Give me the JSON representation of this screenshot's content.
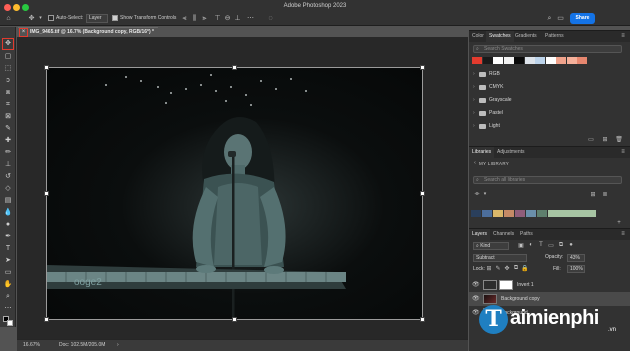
{
  "app": {
    "title": "Adobe Photoshop 2023",
    "share_label": "Share"
  },
  "options_bar": {
    "auto_select_label": "Auto-Select:",
    "auto_select_checked": false,
    "layer_select_value": "Layer",
    "transform_controls_label": "Show Transform Controls",
    "transform_controls_checked": true
  },
  "document": {
    "tab_label": "IMG_9465.tif @ 16.7% (Background copy, RGB/16*) *",
    "close_icon": "×",
    "zoom": "16.67%",
    "doc_info": "Doc: 102.5M/205.0M"
  },
  "swatches_panel": {
    "tabs": [
      "Color",
      "Swatches",
      "Gradients",
      "Patterns"
    ],
    "active_tab": "Swatches",
    "search_placeholder": "Search Swatches",
    "recent_colors": [
      "#e33b2e",
      "#1a1a1a",
      "#ffffff",
      "#f2f2f2",
      "#0a0a0a",
      "#dde3ea",
      "#bcd3ea",
      "#ffffff",
      "#f0a38c",
      "#f5b09a",
      "#e7876f"
    ],
    "folders": [
      "RGB",
      "CMYK",
      "Grayscale",
      "Pastel",
      "Light"
    ]
  },
  "libraries_panel": {
    "tabs": [
      "Libraries",
      "Adjustments"
    ],
    "active_tab": "Libraries",
    "library_name": "MY LIBRARY",
    "search_placeholder": "Search all libraries",
    "colors": [
      "#2a3f5c",
      "#4c6e9c",
      "#d9b76a",
      "#c58a66",
      "#8f5d7a",
      "#6a8faa",
      "#5e7f6d",
      "#a7c4a3"
    ]
  },
  "layers_panel": {
    "tabs": [
      "Layers",
      "Channels",
      "Paths"
    ],
    "active_tab": "Layers",
    "filter_label": "Kind",
    "blend_mode": "Subtract",
    "opacity_label": "Opacity:",
    "opacity_value": "43%",
    "lock_label": "Lock:",
    "fill_label": "Fill:",
    "fill_value": "100%",
    "layers": [
      {
        "name": "Invert 1",
        "visible": true,
        "selected": false
      },
      {
        "name": "Background copy",
        "visible": true,
        "selected": true
      },
      {
        "name": "Background",
        "visible": true,
        "selected": false
      }
    ]
  },
  "watermark": {
    "logo_letter": "T",
    "brand_text": "aimienphi",
    "suffix": ".vn"
  }
}
